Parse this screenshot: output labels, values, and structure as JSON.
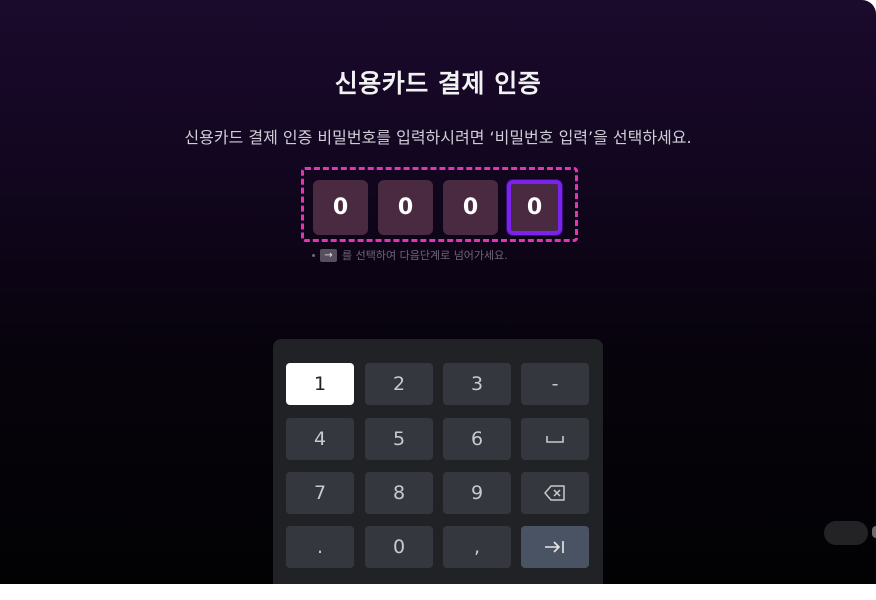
{
  "title": "신용카드 결제 인증",
  "subtitle": "신용카드 결제 인증 비밀번호를 입력하시려면 ‘비밀번호 입력’을 선택하세요.",
  "pin": {
    "digits": [
      "0",
      "0",
      "0",
      "0"
    ],
    "focused_index": 3
  },
  "hint": {
    "key_icon": "→",
    "text": "를 선택하여 다음단계로 넘어가세요."
  },
  "keypad": {
    "keys": [
      {
        "label": "1",
        "icon": "",
        "state": "active"
      },
      {
        "label": "2",
        "icon": "",
        "state": "normal"
      },
      {
        "label": "3",
        "icon": "",
        "state": "normal"
      },
      {
        "label": "-",
        "icon": "",
        "state": "normal"
      },
      {
        "label": "4",
        "icon": "",
        "state": "normal"
      },
      {
        "label": "5",
        "icon": "",
        "state": "normal"
      },
      {
        "label": "6",
        "icon": "",
        "state": "normal"
      },
      {
        "label": "",
        "icon": "space-icon",
        "state": "normal"
      },
      {
        "label": "7",
        "icon": "",
        "state": "normal"
      },
      {
        "label": "8",
        "icon": "",
        "state": "normal"
      },
      {
        "label": "9",
        "icon": "",
        "state": "normal"
      },
      {
        "label": "",
        "icon": "backspace-icon",
        "state": "normal"
      },
      {
        "label": ".",
        "icon": "",
        "state": "normal"
      },
      {
        "label": "0",
        "icon": "",
        "state": "normal"
      },
      {
        "label": ",",
        "icon": "",
        "state": "normal"
      },
      {
        "label": "",
        "icon": "tab-next-icon",
        "state": "accent"
      }
    ]
  },
  "colors": {
    "focus_border": "#7a22ee",
    "dashed_frame": "#e135b4",
    "pin_box": "#4a2a40",
    "keypad_bg": "#212226",
    "key_bg": "#34373d",
    "key_accent": "#4a5363"
  }
}
